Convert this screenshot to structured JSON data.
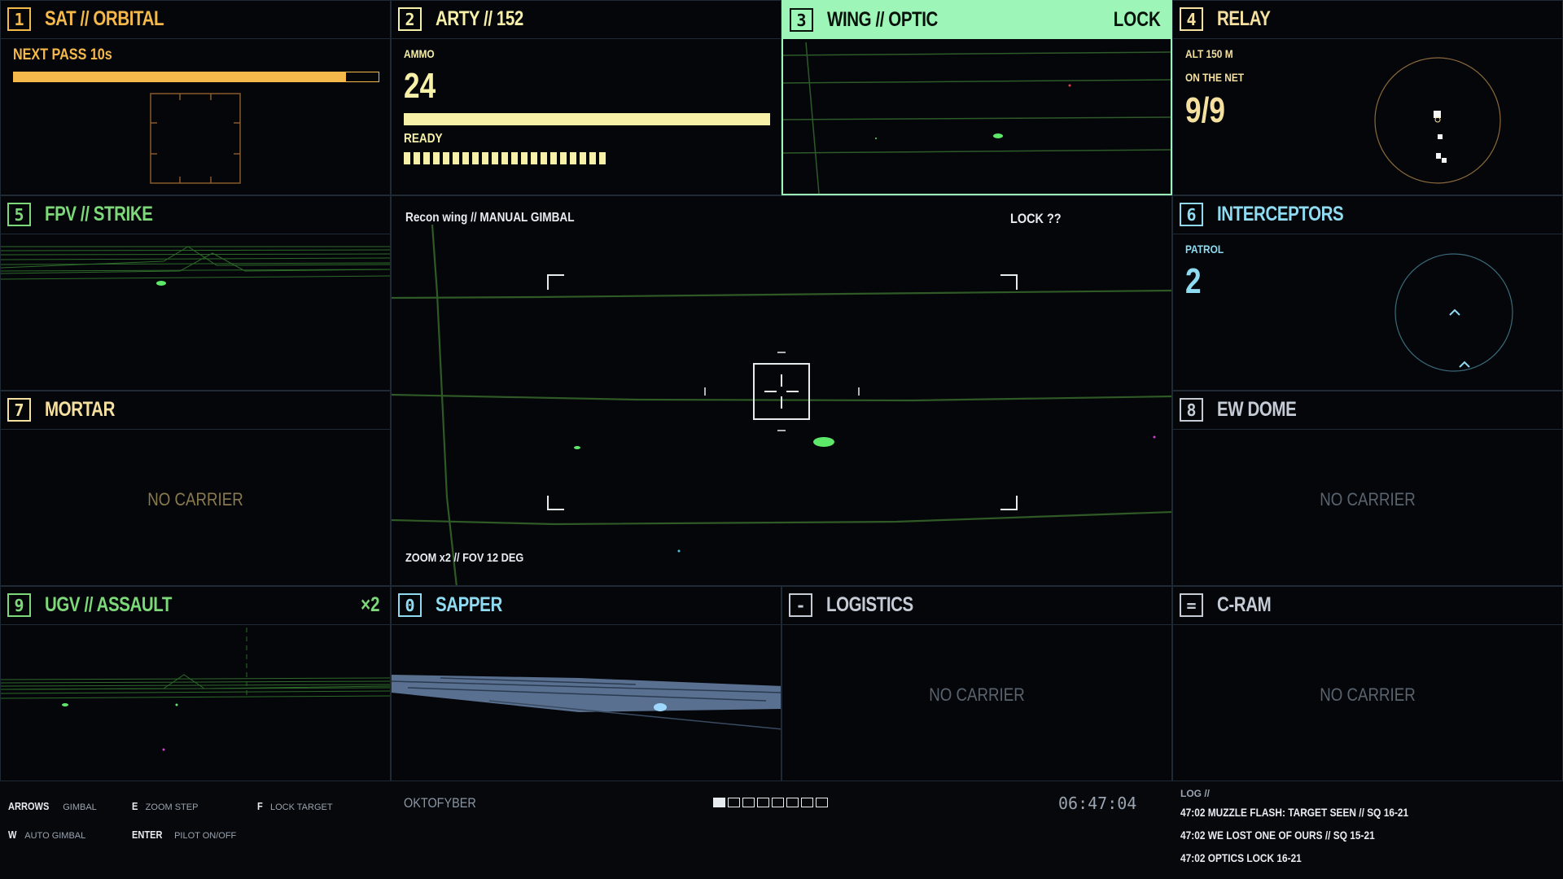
{
  "colors": {
    "orange": "#f5b84a",
    "cream": "#f7f0a8",
    "mint": "#9ef5b8",
    "teal": "#8fdcf2",
    "green": "#7dd87a",
    "sand": "#f5e0a0",
    "grey": "#8a96a4"
  },
  "panels": {
    "sat": {
      "num": "1",
      "title": "SAT // ORBITAL",
      "next_pass": "NEXT PASS 10s",
      "pass_progress": 0.91
    },
    "arty": {
      "num": "2",
      "title": "ARTY // 152",
      "ammo_label": "AMMO",
      "ammo": "24",
      "ammo_fill": 1.0,
      "ready_label": "READY",
      "ready_count": 21
    },
    "wing": {
      "num": "3",
      "title": "WING // OPTIC",
      "status": "LOCK"
    },
    "relay": {
      "num": "4",
      "title": "RELAY",
      "alt": "ALT 150 M",
      "net_label": "ON THE NET",
      "net": "9/9"
    },
    "fpv": {
      "num": "5",
      "title": "FPV // STRIKE"
    },
    "interceptors": {
      "num": "6",
      "title": "INTERCEPTORS",
      "patrol_label": "PATROL",
      "patrol": "2"
    },
    "mortar": {
      "num": "7",
      "title": "MORTAR",
      "status": "NO CARRIER"
    },
    "ewdome": {
      "num": "8",
      "title": "EW DOME",
      "status": "NO CARRIER"
    },
    "ugv": {
      "num": "9",
      "title": "UGV // ASSAULT",
      "count": "×2"
    },
    "sapper": {
      "num": "0",
      "title": "SAPPER"
    },
    "logistics": {
      "num": "-",
      "title": "LOGISTICS",
      "status": "NO CARRIER"
    },
    "cram": {
      "num": "=",
      "title": "C-RAM",
      "status": "NO CARRIER"
    }
  },
  "main_view": {
    "source": "Recon wing // MANUAL GIMBAL",
    "lock": "LOCK ??",
    "zoom": "ZOOM x2 // FOV 12 DEG"
  },
  "controls": [
    {
      "key": "ARROWS",
      "desc": "GIMBAL"
    },
    {
      "key": "E",
      "desc": "ZOOM STEP"
    },
    {
      "key": "F",
      "desc": "LOCK TARGET"
    },
    {
      "key": "W",
      "desc": "AUTO GIMBAL"
    },
    {
      "key": "ENTER",
      "desc": "PILOT ON/OFF"
    }
  ],
  "footer": {
    "callsign": "OKTOFYBER",
    "clock": "06:47:04",
    "pages_total": 8,
    "page_active": 1
  },
  "log": {
    "header": "LOG //",
    "lines": [
      "47:02 MUZZLE FLASH: TARGET SEEN // SQ 16-21",
      "47:02 WE LOST ONE OF OURS // SQ 15-21",
      "47:02 OPTICS LOCK 16-21"
    ]
  }
}
